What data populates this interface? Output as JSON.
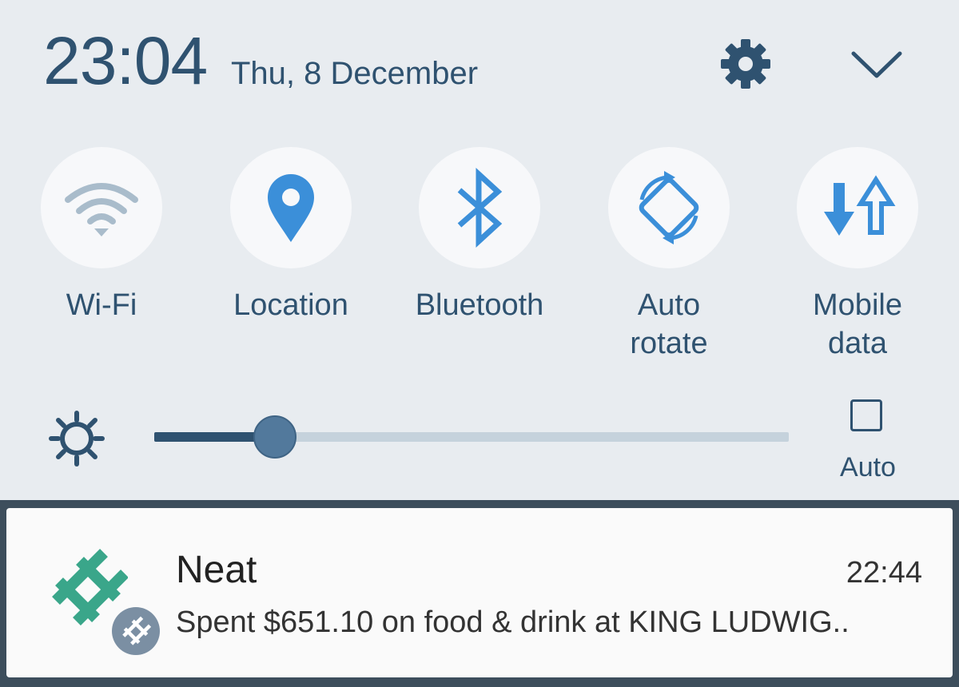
{
  "header": {
    "time": "23:04",
    "date": "Thu, 8 December",
    "settings_icon": "gear-icon",
    "collapse_icon": "chevron-down-icon"
  },
  "quick_toggles": [
    {
      "label": "Wi-Fi",
      "icon": "wifi-icon",
      "active": false
    },
    {
      "label": "Location",
      "icon": "location-pin-icon",
      "active": true
    },
    {
      "label": "Bluetooth",
      "icon": "bluetooth-icon",
      "active": true
    },
    {
      "label": "Auto\nrotate",
      "icon": "auto-rotate-icon",
      "active": true
    },
    {
      "label": "Mobile\ndata",
      "icon": "mobile-data-icon",
      "active": true
    }
  ],
  "brightness": {
    "level": 0.19,
    "auto_label": "Auto",
    "auto_checked": false
  },
  "notification": {
    "app": "Neat",
    "time": "22:44",
    "text": "Spent $651.10 on food & drink at KING LUDWIG.."
  },
  "colors": {
    "accent": "#2f5270",
    "active_icon": "#3b8fd9",
    "inactive_icon": "#a9bccb",
    "app_logo": "#3aa68a"
  }
}
